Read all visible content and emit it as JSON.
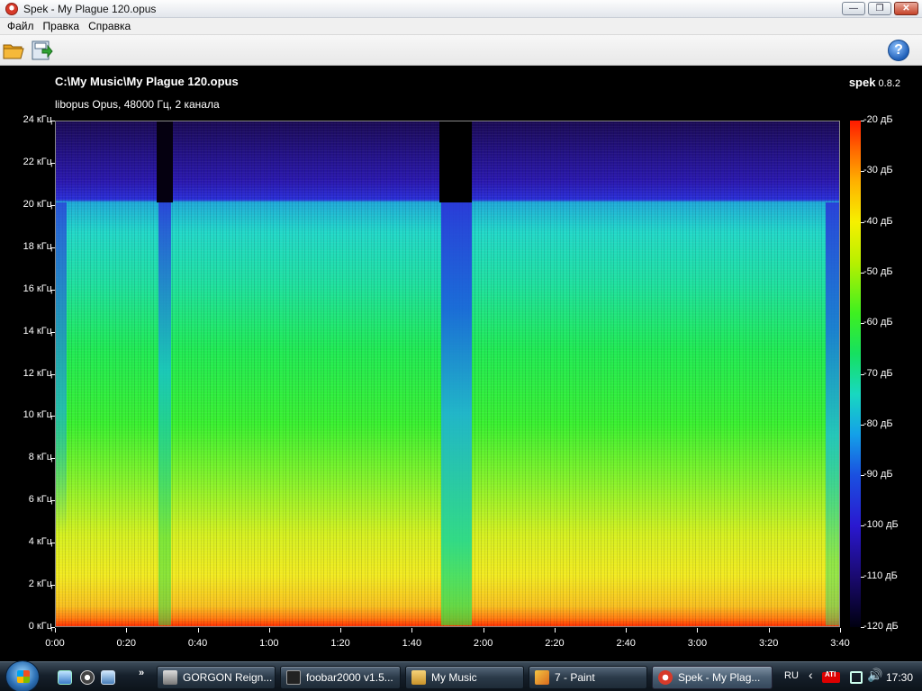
{
  "window": {
    "title": "Spek - My Plague 120.opus",
    "minimize_glyph": "—",
    "maximize_glyph": "❐",
    "close_glyph": "✕"
  },
  "menu": {
    "items": [
      "Файл",
      "Правка",
      "Справка"
    ]
  },
  "toolbar": {
    "open_icon": "folder-open-icon",
    "save_icon": "save-icon",
    "help_icon": "help-icon",
    "help_glyph": "?"
  },
  "spectrogram": {
    "file_path": "C:\\My Music\\My Plague 120.opus",
    "file_info": "libopus Opus, 48000 Гц, 2 канала",
    "brand_name": "spek",
    "brand_version": "0.8.2",
    "y_ticks": [
      "24 кГц",
      "22 кГц",
      "20 кГц",
      "18 кГц",
      "16 кГц",
      "14 кГц",
      "12 кГц",
      "10 кГц",
      "8 кГц",
      "6 кГц",
      "4 кГц",
      "2 кГц",
      "0 кГц"
    ],
    "x_ticks": [
      "0:00",
      "0:20",
      "0:40",
      "1:00",
      "1:20",
      "1:40",
      "2:00",
      "2:20",
      "2:40",
      "3:00",
      "3:20",
      "3:40"
    ],
    "colorbar_ticks": [
      "-20 дБ",
      "-30 дБ",
      "-40 дБ",
      "-50 дБ",
      "-60 дБ",
      "-70 дБ",
      "-80 дБ",
      "-90 дБ",
      "-100 дБ",
      "-110 дБ",
      "-120 дБ"
    ],
    "cutoff_khz": 20,
    "duration": "3:40"
  },
  "taskbar": {
    "quick_launch_more": "»",
    "tasks": [
      {
        "label": "GORGON Reign...",
        "icon": "xm-icon",
        "active": false
      },
      {
        "label": "foobar2000 v1.5...",
        "icon": "foobar-icon",
        "active": false
      },
      {
        "label": "My Music",
        "icon": "folder-icon",
        "active": false
      },
      {
        "label": "7 - Paint",
        "icon": "paint-icon",
        "active": false
      },
      {
        "label": "Spek - My Plag...",
        "icon": "spek-icon",
        "active": true
      }
    ],
    "tray": {
      "language": "RU",
      "arrow": "‹",
      "ati_label": "ATI",
      "volume_glyph": "🔊",
      "clock": "17:30"
    }
  },
  "colors": {
    "accent_blue": "#1f5fb8",
    "cutoff_line": "#2a2fd8"
  }
}
